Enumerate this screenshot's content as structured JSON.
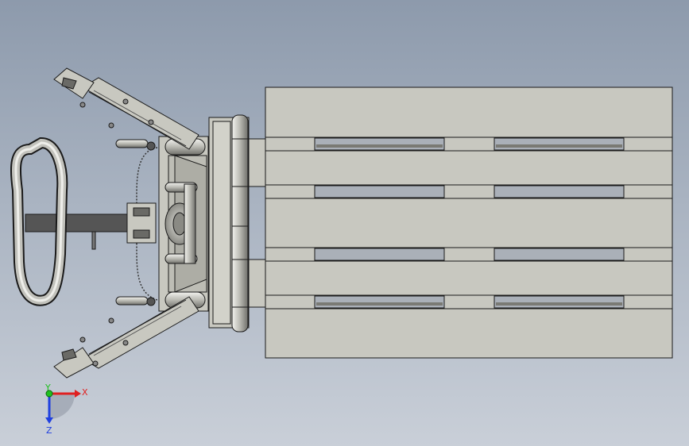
{
  "viewport": {
    "background_top": "#8d9aac",
    "background_bottom": "#c9cfd8"
  },
  "model": {
    "body_color": "#c8c8c0",
    "edge_color": "#1a1a1a",
    "handle_color": "#555555"
  },
  "triad": {
    "x_label": "X",
    "y_label": "Y",
    "z_label": "Z",
    "x_color": "#e02020",
    "y_color": "#20c020",
    "z_color": "#2040e0"
  }
}
